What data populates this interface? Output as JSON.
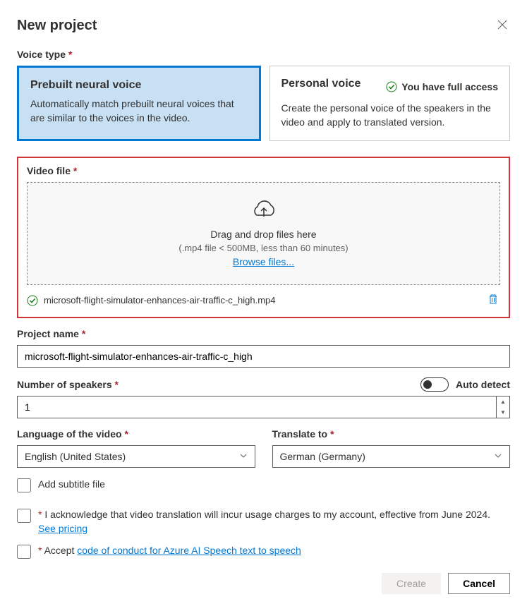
{
  "title": "New project",
  "voice_type": {
    "label": "Voice type",
    "cards": [
      {
        "title": "Prebuilt neural voice",
        "desc": "Automatically match prebuilt neural voices that are similar to the voices in the video.",
        "selected": true
      },
      {
        "title": "Personal voice",
        "desc": "Create the personal voice of the speakers in the video and apply to translated version.",
        "access_badge": "You have full access"
      }
    ]
  },
  "video_file": {
    "label": "Video file",
    "drop_text": "Drag and drop files here",
    "drop_sub": "(.mp4 file < 500MB, less than 60 minutes)",
    "browse": "Browse files...",
    "uploaded": "microsoft-flight-simulator-enhances-air-traffic-c_high.mp4"
  },
  "project_name": {
    "label": "Project name",
    "value": "microsoft-flight-simulator-enhances-air-traffic-c_high"
  },
  "speakers": {
    "label": "Number of speakers",
    "value": "1",
    "auto_detect": "Auto detect",
    "auto_detect_on": false
  },
  "language": {
    "label": "Language of the video",
    "value": "English (United States)"
  },
  "translate": {
    "label": "Translate to",
    "value": "German (Germany)"
  },
  "subtitle": {
    "label": "Add subtitle file"
  },
  "ack1": {
    "text_before": "I acknowledge that video translation will incur usage charges to my account, effective from June 2024. ",
    "link": "See pricing"
  },
  "ack2": {
    "text_before": "Accept ",
    "link": "code of conduct for Azure AI Speech text to speech"
  },
  "footer": {
    "create": "Create",
    "cancel": "Cancel"
  }
}
